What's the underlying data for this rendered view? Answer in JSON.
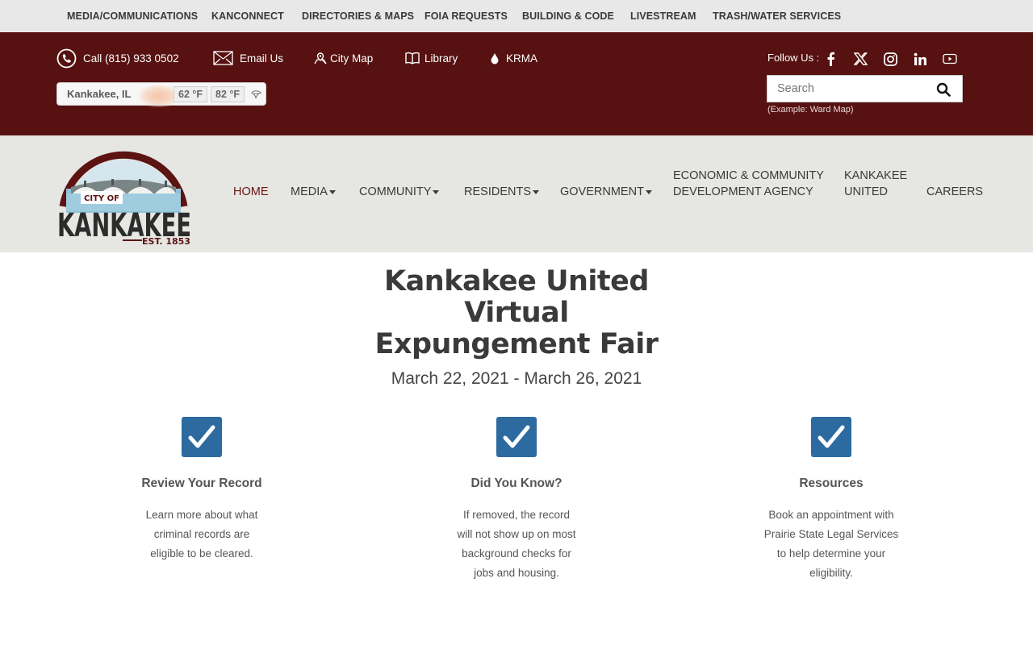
{
  "topbar": {
    "links": [
      "MEDIA/COMMUNICATIONS",
      "KANCONNECT",
      "DIRECTORIES & MAPS",
      "FOIA REQUESTS",
      "BUILDING & CODE",
      "LIVESTREAM",
      "TRASH/WATER SERVICES"
    ]
  },
  "header": {
    "quick_links": [
      {
        "icon": "phone-icon",
        "label": "Call (815) 933 0502"
      },
      {
        "icon": "email-icon",
        "label": "Email Us"
      },
      {
        "icon": "map-icon",
        "label": "City Map"
      },
      {
        "icon": "book-icon",
        "label": "Library"
      },
      {
        "icon": "water-drop-icon",
        "label": "KRMA"
      }
    ],
    "weather": {
      "location": "Kankakee, IL",
      "low": "62 °F",
      "high": "82 °F"
    },
    "follow_label": "Follow Us :",
    "social": [
      "facebook-icon",
      "x-twitter-icon",
      "instagram-icon",
      "linkedin-icon",
      "youtube-icon"
    ],
    "search": {
      "placeholder": "Search",
      "example": "(Example: Ward Map)"
    }
  },
  "logo": {
    "top": "CITY OF",
    "name": "KANKAKEE",
    "est": "EST. 1853"
  },
  "nav": {
    "items": [
      {
        "label": "HOME",
        "dropdown": false,
        "active": true
      },
      {
        "label": "MEDIA",
        "dropdown": true
      },
      {
        "label": "COMMUNITY",
        "dropdown": true
      },
      {
        "label": "RESIDENTS",
        "dropdown": true
      },
      {
        "label": "GOVERNMENT",
        "dropdown": true
      },
      {
        "label_line1": "ECONOMIC & COMMUNITY",
        "label_line2": "DEVELOPMENT AGENCY"
      },
      {
        "label_line1": "KANKAKEE",
        "label_line2": "UNITED"
      },
      {
        "label": "CAREERS"
      }
    ]
  },
  "hero": {
    "title_lines": [
      "Kankakee United",
      "Virtual",
      "Expungement Fair"
    ],
    "dates": "March 22, 2021 - March 26, 2021"
  },
  "columns": [
    {
      "heading": "Review Your Record",
      "lines": [
        "Learn more about what",
        "criminal records are",
        "eligible to be cleared."
      ]
    },
    {
      "heading": "Did You Know?",
      "lines": [
        "If removed, the record",
        "will not show up on most",
        "background checks for",
        "jobs and housing."
      ]
    },
    {
      "heading": "Resources",
      "lines": [
        "Book an appointment with",
        "Prairie State Legal Services",
        "to help determine your",
        "eligibility."
      ]
    }
  ],
  "colors": {
    "maroon": "#561110",
    "nav_bg": "#e6e6e3",
    "check_blue": "#2c6aa0",
    "active_nav": "#6b1512"
  }
}
